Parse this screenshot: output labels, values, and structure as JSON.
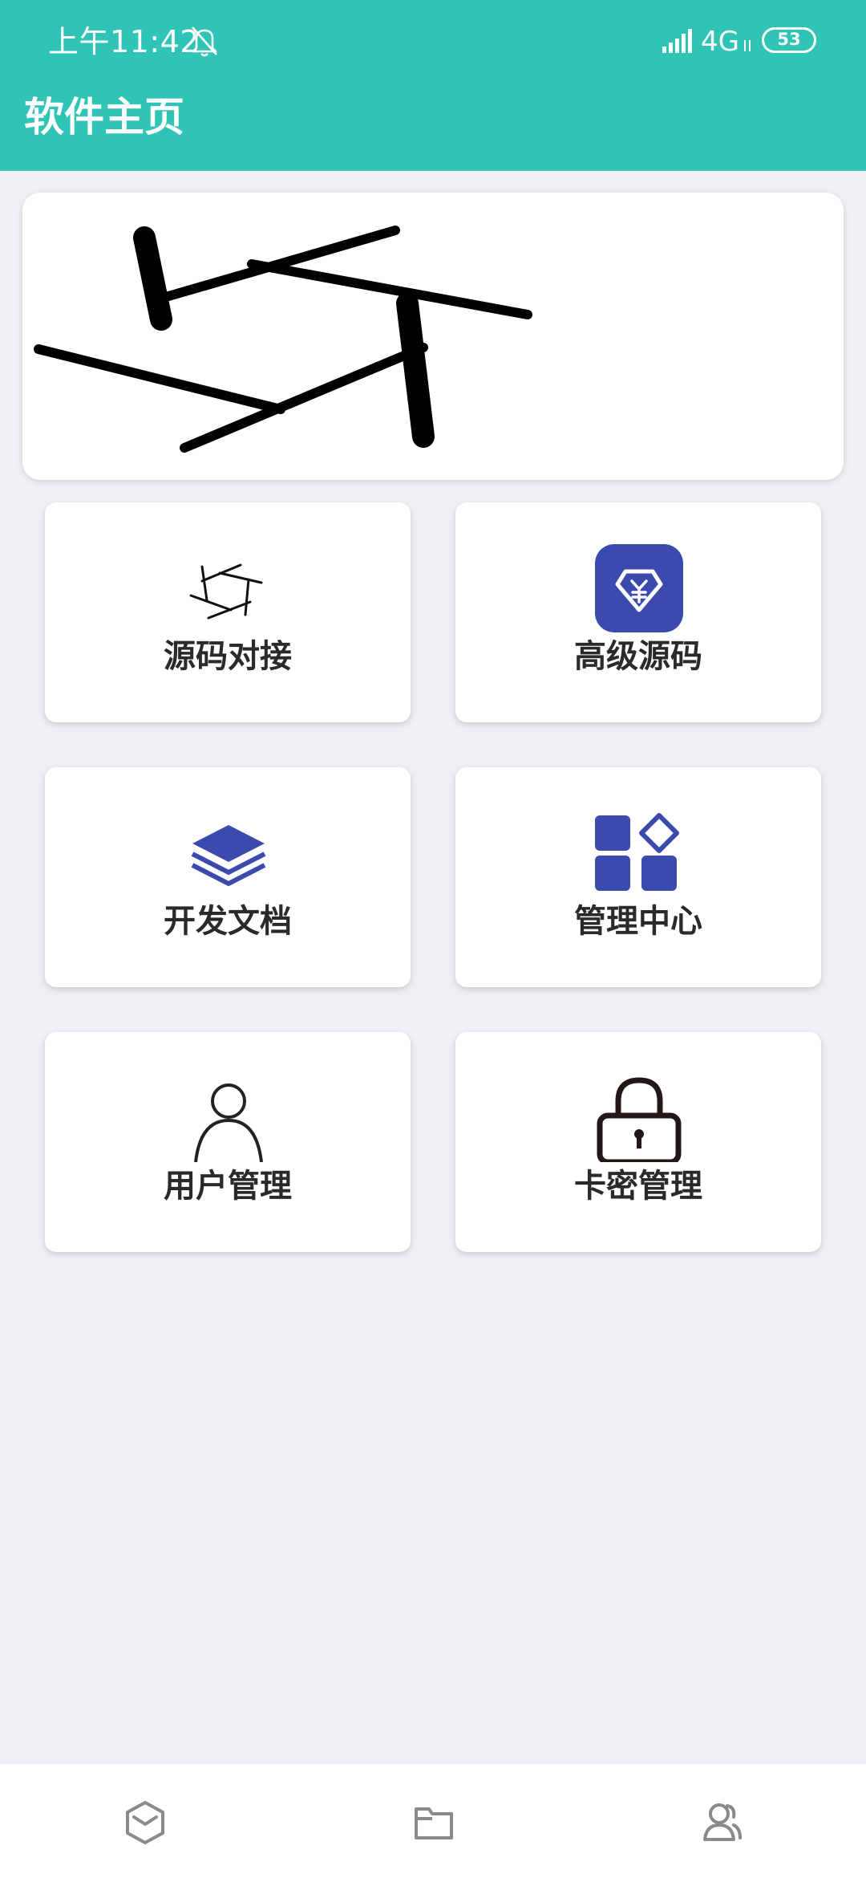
{
  "status_bar": {
    "time": "上午11:42",
    "network": "4G",
    "battery": "53"
  },
  "header": {
    "title": "软件主页"
  },
  "tiles": [
    {
      "label": "源码对接",
      "icon": "shutter-icon"
    },
    {
      "label": "高级源码",
      "icon": "diamond-yen-icon"
    },
    {
      "label": "开发文档",
      "icon": "layers-icon"
    },
    {
      "label": "管理中心",
      "icon": "apps-grid-icon"
    },
    {
      "label": "用户管理",
      "icon": "user-icon"
    },
    {
      "label": "卡密管理",
      "icon": "lock-icon"
    }
  ],
  "bottom_nav": [
    {
      "icon": "home-cube-icon"
    },
    {
      "icon": "folder-icon"
    },
    {
      "icon": "users-icon"
    }
  ],
  "colors": {
    "primary": "#2fc4b6",
    "accent": "#3a4aad",
    "background": "#efeff4"
  }
}
